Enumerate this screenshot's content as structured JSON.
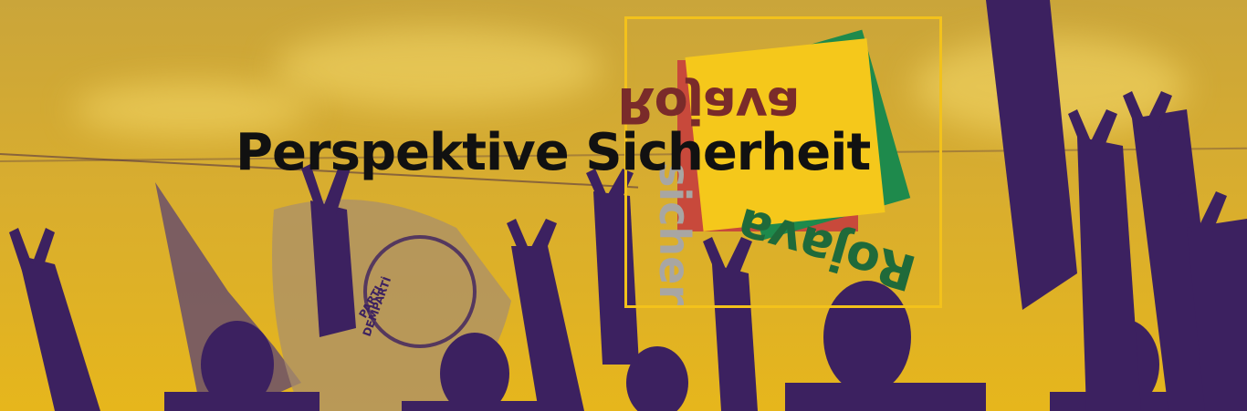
{
  "banner": {
    "headline": "Perspektive Sicherheit",
    "logo": {
      "word_top": "Rojava",
      "word_bottom": "Rojava",
      "word_vertical": "sicher"
    },
    "flag_text": [
      "PARTI",
      "DEMPARTİ"
    ]
  },
  "colors": {
    "duotone_light": "#e6b61c",
    "duotone_dark": "#3c2160",
    "frame": "#f3c21b",
    "square_red": "#c8493b",
    "square_green": "#1e8a4c",
    "square_yellow": "#f5c81b",
    "headline": "#111111"
  }
}
